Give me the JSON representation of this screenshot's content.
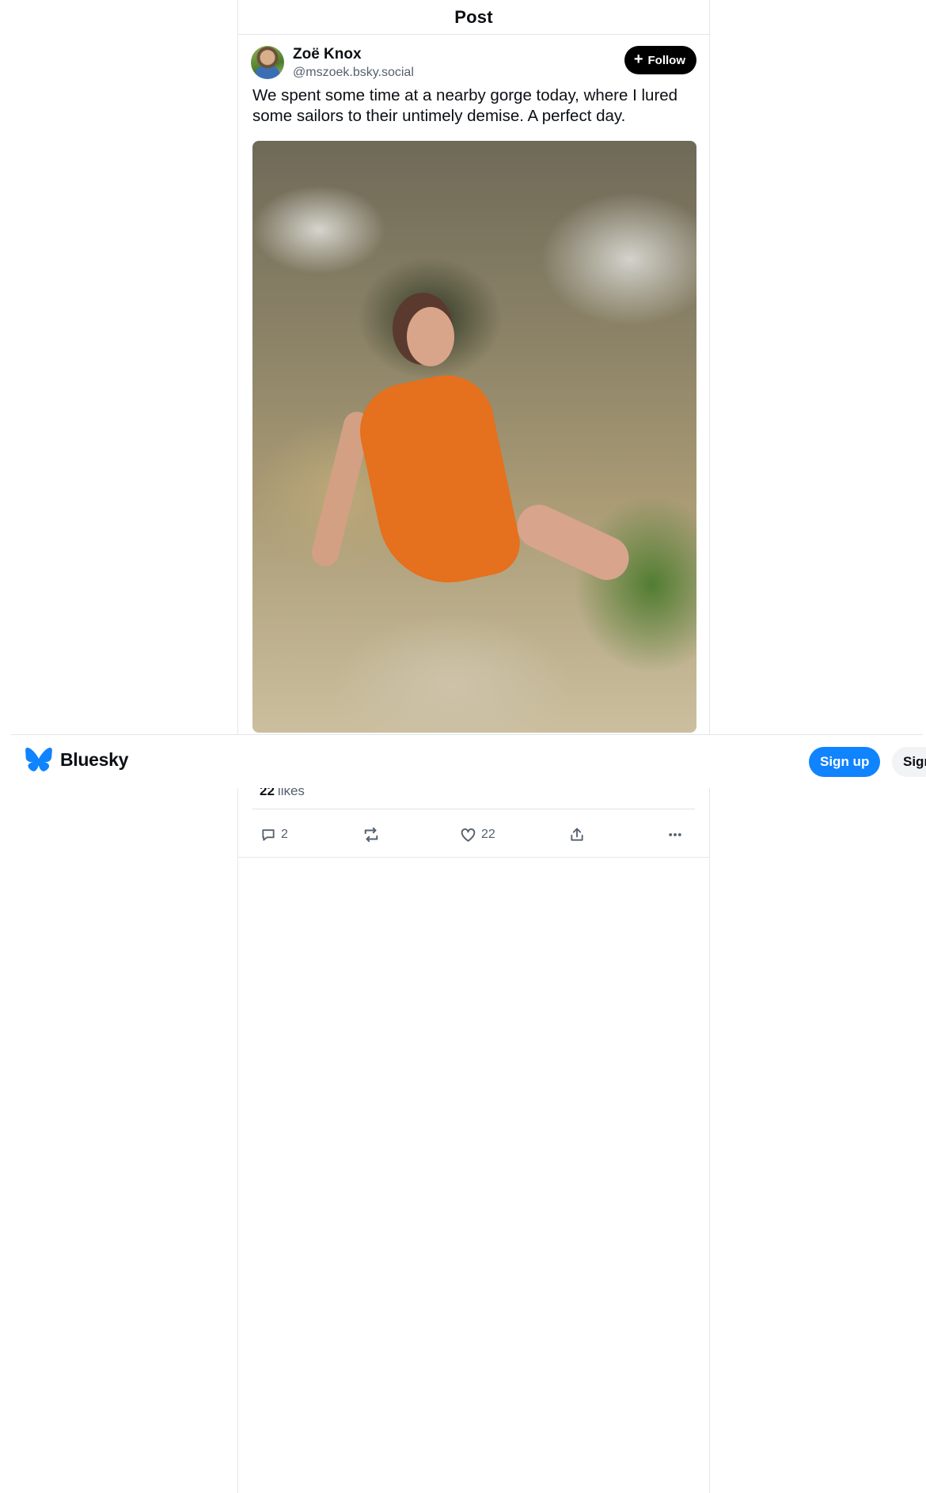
{
  "screen": {
    "title": "Post"
  },
  "author": {
    "name": "Zoë Knox",
    "handle": "@mszoek.bsky.social"
  },
  "follow_button": {
    "label": "Follow"
  },
  "post": {
    "text": "We spent some time at a nearby gorge today, where I lured some sailors to their untimely demise. A perfect day."
  },
  "stats": {
    "likes_count": "22",
    "likes_label": "likes"
  },
  "actions": {
    "reply_count": "2",
    "repost_count": "",
    "like_count": "22"
  },
  "header": {
    "brand": "Bluesky",
    "signup_label": "Sign up",
    "signin_label": "Sign"
  },
  "colors": {
    "brand_blue": "#1083fe",
    "text": "#0b0f14",
    "muted": "#55606e",
    "follow_bg": "#000000"
  }
}
